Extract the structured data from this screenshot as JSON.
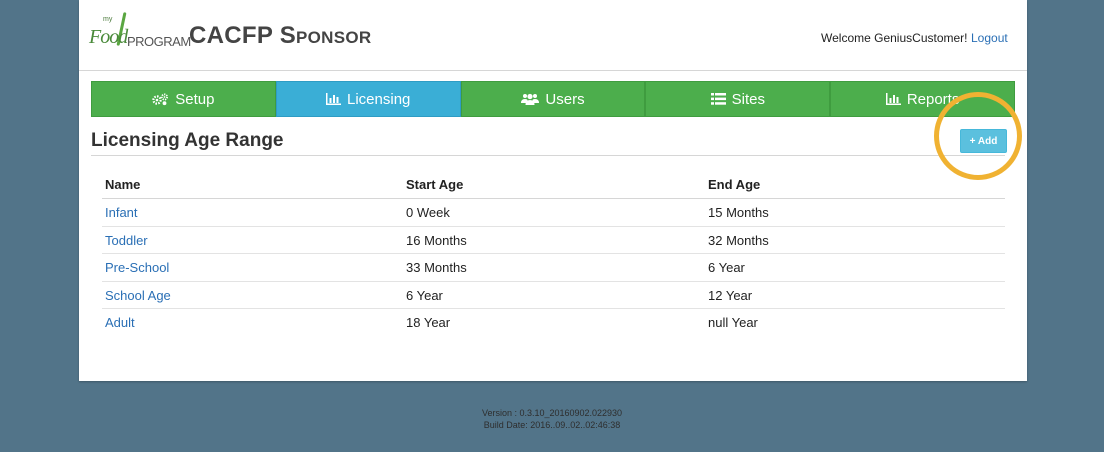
{
  "header": {
    "logo_my": "my",
    "logo_food": "Food",
    "logo_program": "PROGRAM",
    "app_title": "CACFP Sponsor",
    "welcome": "Welcome GeniusCustomer!",
    "logout": "Logout"
  },
  "nav": {
    "tabs": [
      {
        "label": "Setup",
        "icon": "gears-icon"
      },
      {
        "label": "Licensing",
        "icon": "bar-chart-icon",
        "active": true
      },
      {
        "label": "Users",
        "icon": "users-icon"
      },
      {
        "label": "Sites",
        "icon": "list-icon"
      },
      {
        "label": "Reports",
        "icon": "bar-chart-icon"
      }
    ]
  },
  "main": {
    "title": "Licensing Age Range",
    "add_label": "+ Add",
    "table": {
      "columns": [
        "Name",
        "Start Age",
        "End Age"
      ],
      "rows": [
        {
          "name": "Infant",
          "start": "0 Week",
          "end": "15 Months"
        },
        {
          "name": "Toddler",
          "start": "16 Months",
          "end": "32 Months"
        },
        {
          "name": "Pre-School",
          "start": "33 Months",
          "end": "6 Year"
        },
        {
          "name": "School Age",
          "start": "6 Year",
          "end": "12 Year"
        },
        {
          "name": "Adult",
          "start": "18 Year",
          "end": "null Year"
        }
      ]
    }
  },
  "footer": {
    "version": "Version : 0.3.10_20160902.022930",
    "build_date": "Build Date: 2016..09..02..02:46:38"
  },
  "colors": {
    "background": "#527489",
    "nav_green": "#4cae4c",
    "nav_active": "#3aaed6",
    "add_button": "#5bc0de",
    "highlight_ring": "#f0b232",
    "link": "#2a6fb5"
  }
}
